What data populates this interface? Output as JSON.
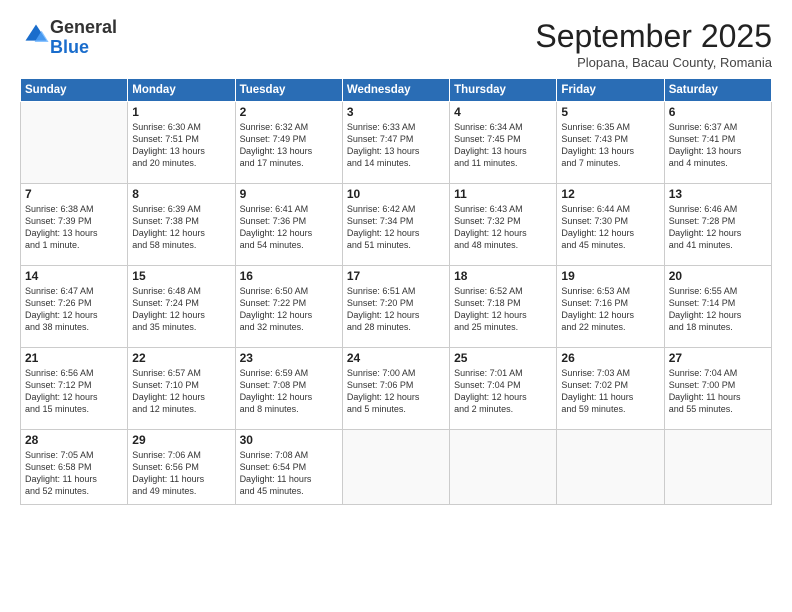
{
  "logo": {
    "general": "General",
    "blue": "Blue"
  },
  "title": "September 2025",
  "subtitle": "Plopana, Bacau County, Romania",
  "days": [
    "Sunday",
    "Monday",
    "Tuesday",
    "Wednesday",
    "Thursday",
    "Friday",
    "Saturday"
  ],
  "weeks": [
    [
      {
        "day": "",
        "content": ""
      },
      {
        "day": "1",
        "content": "Sunrise: 6:30 AM\nSunset: 7:51 PM\nDaylight: 13 hours\nand 20 minutes."
      },
      {
        "day": "2",
        "content": "Sunrise: 6:32 AM\nSunset: 7:49 PM\nDaylight: 13 hours\nand 17 minutes."
      },
      {
        "day": "3",
        "content": "Sunrise: 6:33 AM\nSunset: 7:47 PM\nDaylight: 13 hours\nand 14 minutes."
      },
      {
        "day": "4",
        "content": "Sunrise: 6:34 AM\nSunset: 7:45 PM\nDaylight: 13 hours\nand 11 minutes."
      },
      {
        "day": "5",
        "content": "Sunrise: 6:35 AM\nSunset: 7:43 PM\nDaylight: 13 hours\nand 7 minutes."
      },
      {
        "day": "6",
        "content": "Sunrise: 6:37 AM\nSunset: 7:41 PM\nDaylight: 13 hours\nand 4 minutes."
      }
    ],
    [
      {
        "day": "7",
        "content": "Sunrise: 6:38 AM\nSunset: 7:39 PM\nDaylight: 13 hours\nand 1 minute."
      },
      {
        "day": "8",
        "content": "Sunrise: 6:39 AM\nSunset: 7:38 PM\nDaylight: 12 hours\nand 58 minutes."
      },
      {
        "day": "9",
        "content": "Sunrise: 6:41 AM\nSunset: 7:36 PM\nDaylight: 12 hours\nand 54 minutes."
      },
      {
        "day": "10",
        "content": "Sunrise: 6:42 AM\nSunset: 7:34 PM\nDaylight: 12 hours\nand 51 minutes."
      },
      {
        "day": "11",
        "content": "Sunrise: 6:43 AM\nSunset: 7:32 PM\nDaylight: 12 hours\nand 48 minutes."
      },
      {
        "day": "12",
        "content": "Sunrise: 6:44 AM\nSunset: 7:30 PM\nDaylight: 12 hours\nand 45 minutes."
      },
      {
        "day": "13",
        "content": "Sunrise: 6:46 AM\nSunset: 7:28 PM\nDaylight: 12 hours\nand 41 minutes."
      }
    ],
    [
      {
        "day": "14",
        "content": "Sunrise: 6:47 AM\nSunset: 7:26 PM\nDaylight: 12 hours\nand 38 minutes."
      },
      {
        "day": "15",
        "content": "Sunrise: 6:48 AM\nSunset: 7:24 PM\nDaylight: 12 hours\nand 35 minutes."
      },
      {
        "day": "16",
        "content": "Sunrise: 6:50 AM\nSunset: 7:22 PM\nDaylight: 12 hours\nand 32 minutes."
      },
      {
        "day": "17",
        "content": "Sunrise: 6:51 AM\nSunset: 7:20 PM\nDaylight: 12 hours\nand 28 minutes."
      },
      {
        "day": "18",
        "content": "Sunrise: 6:52 AM\nSunset: 7:18 PM\nDaylight: 12 hours\nand 25 minutes."
      },
      {
        "day": "19",
        "content": "Sunrise: 6:53 AM\nSunset: 7:16 PM\nDaylight: 12 hours\nand 22 minutes."
      },
      {
        "day": "20",
        "content": "Sunrise: 6:55 AM\nSunset: 7:14 PM\nDaylight: 12 hours\nand 18 minutes."
      }
    ],
    [
      {
        "day": "21",
        "content": "Sunrise: 6:56 AM\nSunset: 7:12 PM\nDaylight: 12 hours\nand 15 minutes."
      },
      {
        "day": "22",
        "content": "Sunrise: 6:57 AM\nSunset: 7:10 PM\nDaylight: 12 hours\nand 12 minutes."
      },
      {
        "day": "23",
        "content": "Sunrise: 6:59 AM\nSunset: 7:08 PM\nDaylight: 12 hours\nand 8 minutes."
      },
      {
        "day": "24",
        "content": "Sunrise: 7:00 AM\nSunset: 7:06 PM\nDaylight: 12 hours\nand 5 minutes."
      },
      {
        "day": "25",
        "content": "Sunrise: 7:01 AM\nSunset: 7:04 PM\nDaylight: 12 hours\nand 2 minutes."
      },
      {
        "day": "26",
        "content": "Sunrise: 7:03 AM\nSunset: 7:02 PM\nDaylight: 11 hours\nand 59 minutes."
      },
      {
        "day": "27",
        "content": "Sunrise: 7:04 AM\nSunset: 7:00 PM\nDaylight: 11 hours\nand 55 minutes."
      }
    ],
    [
      {
        "day": "28",
        "content": "Sunrise: 7:05 AM\nSunset: 6:58 PM\nDaylight: 11 hours\nand 52 minutes."
      },
      {
        "day": "29",
        "content": "Sunrise: 7:06 AM\nSunset: 6:56 PM\nDaylight: 11 hours\nand 49 minutes."
      },
      {
        "day": "30",
        "content": "Sunrise: 7:08 AM\nSunset: 6:54 PM\nDaylight: 11 hours\nand 45 minutes."
      },
      {
        "day": "",
        "content": ""
      },
      {
        "day": "",
        "content": ""
      },
      {
        "day": "",
        "content": ""
      },
      {
        "day": "",
        "content": ""
      }
    ]
  ]
}
